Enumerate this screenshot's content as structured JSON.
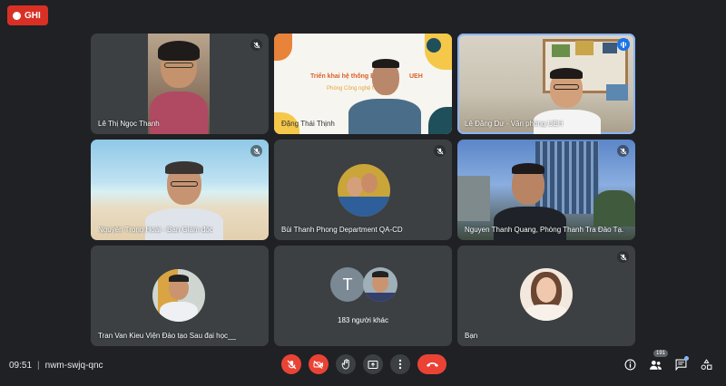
{
  "recording": {
    "label": "GHI",
    "color": "#d93025"
  },
  "tiles": [
    {
      "name": "Lê Thị Ngọc Thanh",
      "muted": true
    },
    {
      "name": "Đặng Thái Thịnh",
      "slide_title": "Triển khai hệ thống E",
      "slide_title_right": "UEH",
      "slide_subtitle": "Phòng Công nghệ t"
    },
    {
      "name": "Lê Đăng Dư - Văn phòng UEH",
      "speaking": true
    },
    {
      "name": "Nguyễn Trọng Hoài - Ban Giám đốc",
      "muted": true
    },
    {
      "name": "Bùi Thanh Phong Department QA-CD",
      "muted": true
    },
    {
      "name": "Nguyen Thanh Quang, Phòng Thanh Tra Đào Tạ...",
      "muted": true
    },
    {
      "name": "Tran Van Kieu Viện Đào tạo Sau đại học__"
    },
    {
      "name": "183 người khác",
      "avatar_letter": "T"
    },
    {
      "name": "Bạn",
      "muted": true
    }
  ],
  "bottom_bar": {
    "time": "09:51",
    "separator": "|",
    "meeting_code": "nwm-swjq-qnc",
    "controls": [
      "mic-off-icon",
      "camera-off-icon",
      "raise-hand-icon",
      "present-icon",
      "more-options-icon",
      "end-call-icon"
    ],
    "people_count": "191",
    "accent_color": "#ea4335"
  }
}
